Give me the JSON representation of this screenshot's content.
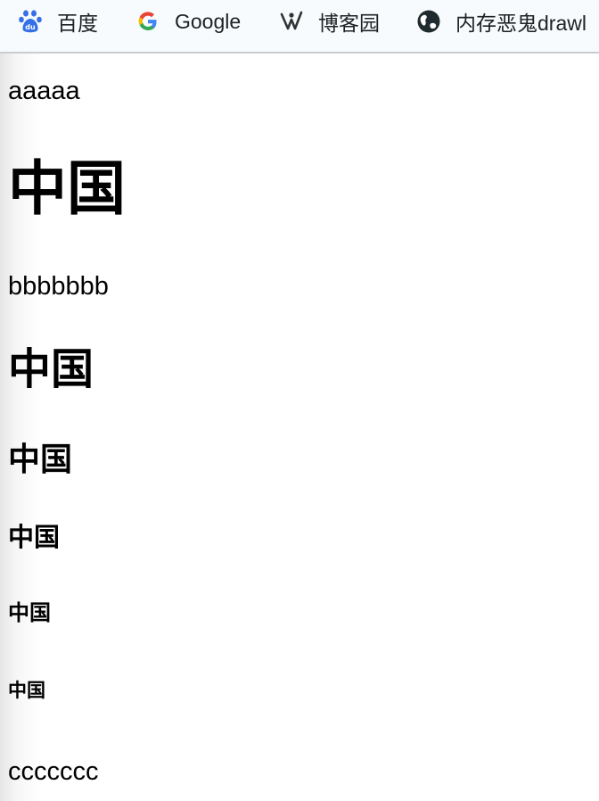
{
  "bookmarks": [
    {
      "label": "百度",
      "icon": "baidu-paw-icon"
    },
    {
      "label": "Google",
      "icon": "google-g-icon"
    },
    {
      "label": "博客园",
      "icon": "cnblogs-logo-icon"
    },
    {
      "label": "内存恶鬼drawl",
      "icon": "globe-icon"
    }
  ],
  "content": {
    "line1": "aaaaa",
    "h1": "中国",
    "line2": "bbbbbbb",
    "h2": "中国",
    "h3": "中国",
    "h4": "中国",
    "h5": "中国",
    "h6": "中国",
    "line3": "ccccccc"
  },
  "colors": {
    "bookmark_bar_bg": "#f7fbfd",
    "bookmark_bar_border": "#c9cdd1",
    "baidu_blue": "#3570e6",
    "text": "#000000"
  }
}
